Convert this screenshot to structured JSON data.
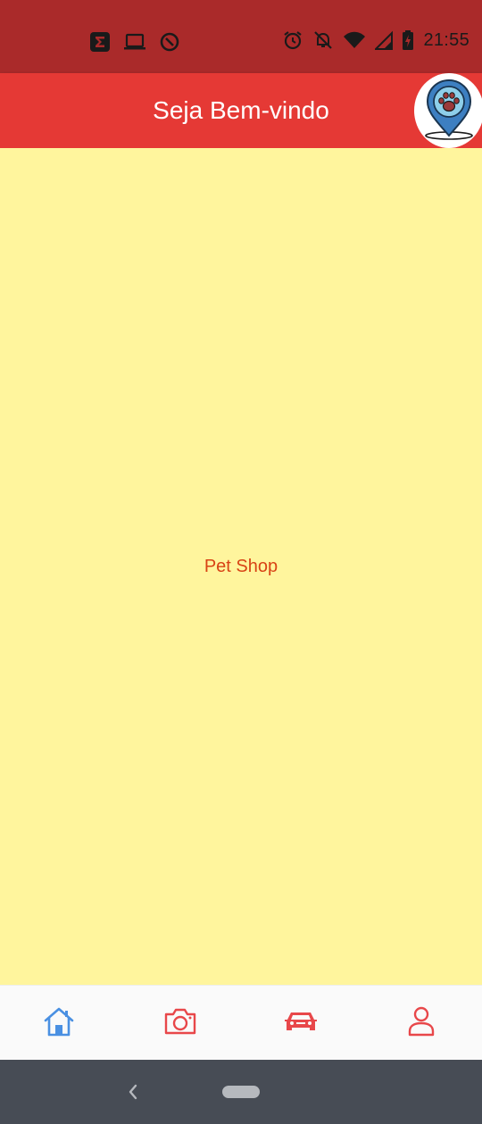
{
  "status_bar": {
    "time": "21:55",
    "left_icons": [
      "sigma-app-icon",
      "laptop-icon",
      "data-saver-icon"
    ],
    "right_icons": [
      "alarm-icon",
      "notifications-off-icon",
      "wifi-icon",
      "signal-icon",
      "battery-charging-icon"
    ]
  },
  "app_bar": {
    "title": "Seja Bem-vindo",
    "avatar_icon": "paw-location-pin-icon"
  },
  "content": {
    "center_label": "Pet Shop"
  },
  "bottom_nav": {
    "items": [
      {
        "icon": "home-icon",
        "active": true
      },
      {
        "icon": "camera-icon",
        "active": false
      },
      {
        "icon": "car-icon",
        "active": false
      },
      {
        "icon": "person-icon",
        "active": false
      }
    ]
  },
  "colors": {
    "status_bar": "#AA2A2A",
    "app_bar": "#E53935",
    "background": "#FFF59D",
    "label": "#D84315",
    "nav_active": "#4A90E2",
    "nav_inactive": "#E8474A",
    "system_nav": "#474C55"
  }
}
